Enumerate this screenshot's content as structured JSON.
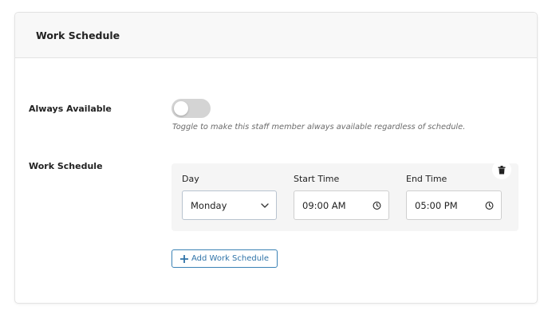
{
  "card": {
    "title": "Work Schedule"
  },
  "always_available": {
    "label": "Always Available",
    "enabled": false,
    "helper": "Toggle to make this staff member always available regardless of schedule."
  },
  "work_schedule": {
    "label": "Work Schedule",
    "columns": {
      "day": "Day",
      "start": "Start Time",
      "end": "End Time"
    },
    "entry": {
      "day": "Monday",
      "start": "09:00 AM",
      "end": "05:00 PM"
    },
    "add_label": "Add Work Schedule"
  },
  "icons": {
    "delete": "trash-icon",
    "dropdown": "chevron-down-icon",
    "time": "clock-icon",
    "add": "plus-icon"
  },
  "colors": {
    "accent": "#2f73a8",
    "toggle_off": "#d4d4d4"
  }
}
